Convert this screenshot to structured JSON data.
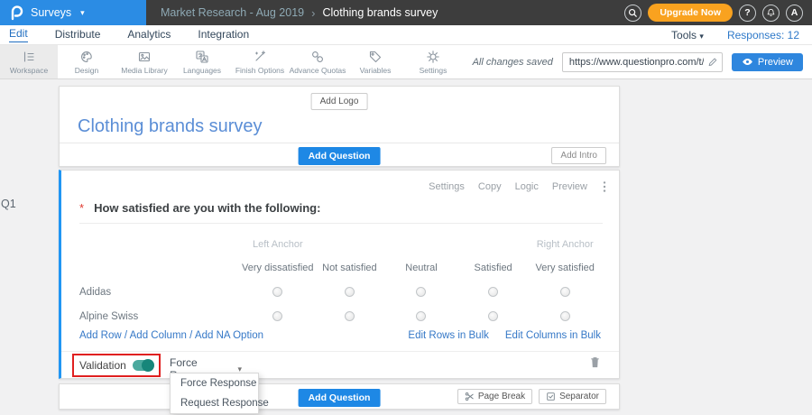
{
  "topbar": {
    "product_label": "Surveys",
    "caret": "▾",
    "breadcrumb_folder": "Market Research - Aug 2019",
    "breadcrumb_sep": "›",
    "breadcrumb_current": "Clothing brands survey",
    "upgrade_label": "Upgrade Now",
    "help_label": "?",
    "avatar_initial": "A"
  },
  "nav": {
    "items": [
      "Edit",
      "Distribute",
      "Analytics",
      "Integration"
    ],
    "active_item": "Edit",
    "tools_label": "Tools",
    "caret": "▾",
    "responses_label": "Responses: 12"
  },
  "toolbar": {
    "items": [
      "Workspace",
      "Design",
      "Media Library",
      "Languages",
      "Finish Options",
      "Advance Quotas",
      "Variables",
      "Settings"
    ],
    "active_item": "Workspace",
    "saved_status": "All changes saved",
    "survey_url": "https://www.questionpro.com/t/APNrFZ",
    "preview_label": "Preview"
  },
  "canvas": {
    "add_logo_label": "Add Logo",
    "survey_title": "Clothing brands survey",
    "add_question_label": "Add Question",
    "add_intro_label": "Add Intro"
  },
  "question": {
    "id": "Q1",
    "actions": [
      "Settings",
      "Copy",
      "Logic",
      "Preview"
    ],
    "required_marker": "*",
    "text": "How satisfied are you with the following:",
    "left_anchor": "Left Anchor",
    "right_anchor": "Right Anchor",
    "columns": [
      "Very dissatisfied",
      "Not satisfied",
      "Neutral",
      "Satisfied",
      "Very satisfied"
    ],
    "rows": [
      "Adidas",
      "Alpine Swiss"
    ],
    "add_row_label": "Add Row",
    "add_column_label": "Add Column",
    "add_na_label": "Add NA Option",
    "link_separator": "/",
    "edit_rows_bulk_label": "Edit Rows in Bulk",
    "edit_columns_bulk_label": "Edit Columns in Bulk",
    "validation_label": "Validation",
    "validation_on": true,
    "response_dropdown_value": "Force Response",
    "dropdown_caret": "▾",
    "dropdown_options": [
      "Force Response",
      "Request Response"
    ]
  },
  "footer": {
    "add_question_label": "Add Question",
    "page_break_label": "Page Break",
    "separator_label": "Separator"
  },
  "icons": {
    "kebab": "vertical-ellipsis",
    "search": "magnifier",
    "bell": "notifications",
    "pencil": "edit-url",
    "eye": "preview",
    "trash": "delete-question",
    "scissors": "page-break",
    "checkbox": "separator"
  },
  "colors": {
    "topbar_bg": "#3d3d3d",
    "brand_blue": "#2b8ce4",
    "upgrade_orange": "#f9a21f",
    "title_blue": "#5b8ed6",
    "link_blue": "#3578c7",
    "primary_button_blue": "#1e88e5",
    "question_border_blue": "#2196f3",
    "toggle_teal": "#2a9d8f",
    "highlight_red": "#e02020"
  }
}
